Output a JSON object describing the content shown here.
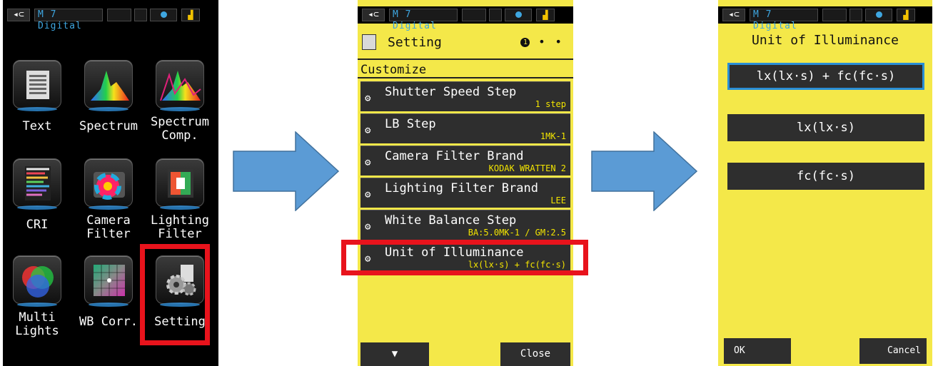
{
  "status": {
    "usb": "◂⊂",
    "mode": "M 7 Digital"
  },
  "screen1": {
    "tiles": [
      {
        "label": "Text"
      },
      {
        "label": "Spectrum"
      },
      {
        "label": "Spectrum\nComp."
      },
      {
        "label": "CRI"
      },
      {
        "label": "Camera\nFilter"
      },
      {
        "label": "Lighting\nFilter"
      },
      {
        "label": "Multi\nLights"
      },
      {
        "label": "WB Corr."
      },
      {
        "label": "Setting"
      }
    ]
  },
  "screen2": {
    "title": "Setting",
    "page_current": "1",
    "page_dots": "• •",
    "section": "Customize",
    "items": [
      {
        "name": "Shutter Speed Step",
        "value": "1 step"
      },
      {
        "name": "LB Step",
        "value": "1MK-1"
      },
      {
        "name": "Camera Filter Brand",
        "value": "KODAK WRATTEN 2"
      },
      {
        "name": "Lighting Filter Brand",
        "value": "LEE"
      },
      {
        "name": "White Balance Step",
        "value": "BA:5.0MK-1 / GM:2.5"
      },
      {
        "name": "Unit of Illuminance",
        "value": "lx(lx·s) + fc(fc·s)"
      }
    ],
    "down_label": "▼",
    "close_label": "Close"
  },
  "screen3": {
    "title": "Unit of Illuminance",
    "options": [
      "lx(lx·s) + fc(fc·s)",
      "lx(lx·s)",
      "fc(fc·s)"
    ],
    "selected_index": 0,
    "ok_label": "OK",
    "cancel_label": "Cancel"
  },
  "colors": {
    "highlight": "#e8131c",
    "accent": "#2a8fd6",
    "screen_yellow": "#f4e849",
    "arrow": "#5b9bd5"
  }
}
